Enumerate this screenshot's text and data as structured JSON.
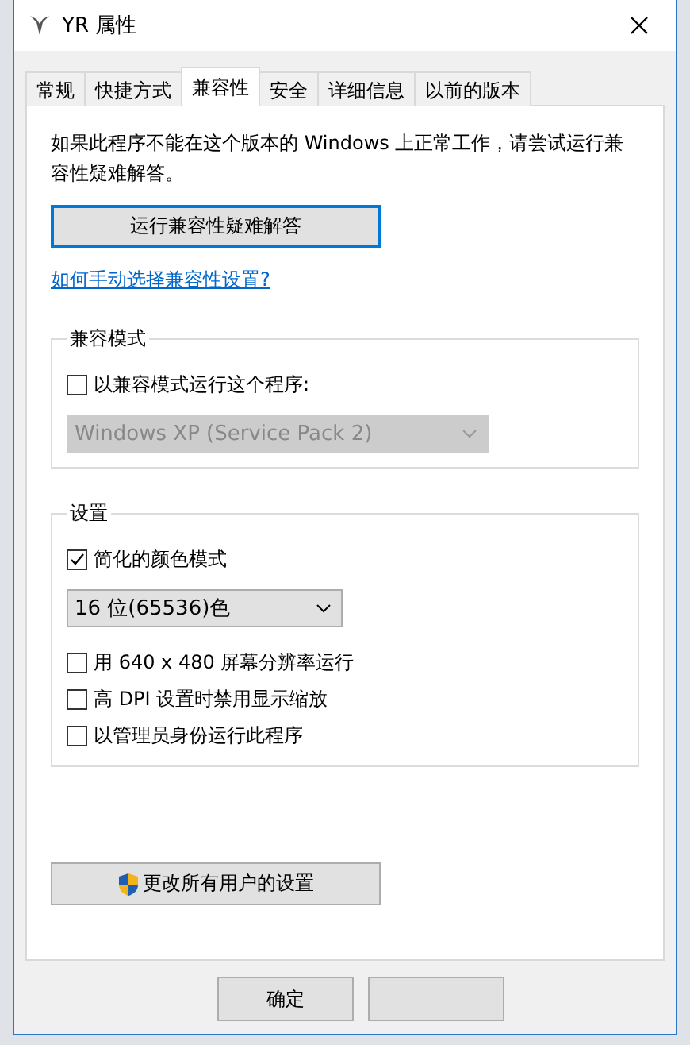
{
  "window": {
    "title": "YR 属性"
  },
  "tabs": [
    {
      "label": "常规",
      "selected": false
    },
    {
      "label": "快捷方式",
      "selected": false
    },
    {
      "label": "兼容性",
      "selected": true
    },
    {
      "label": "安全",
      "selected": false
    },
    {
      "label": "详细信息",
      "selected": false
    },
    {
      "label": "以前的版本",
      "selected": false
    }
  ],
  "intro": "如果此程序不能在这个版本的 Windows 上正常工作，请尝试运行兼容性疑难解答。",
  "troubleshoot_button": "运行兼容性疑难解答",
  "help_link": "如何手动选择兼容性设置?",
  "groups": [
    {
      "title": "兼容模式",
      "items": [
        {
          "kind": "checkbox",
          "label": "以兼容模式运行这个程序:",
          "checked": false
        },
        {
          "kind": "dropdown",
          "value": "Windows XP (Service Pack 2)",
          "disabled": true
        }
      ]
    },
    {
      "title": "设置",
      "items": [
        {
          "kind": "checkbox",
          "label": "简化的颜色模式",
          "checked": true
        },
        {
          "kind": "dropdown",
          "value": "16 位(65536)色",
          "disabled": false
        },
        {
          "kind": "checkbox",
          "label": "用 640 x 480 屏幕分辨率运行",
          "checked": false
        },
        {
          "kind": "checkbox",
          "label": "高 DPI 设置时禁用显示缩放",
          "checked": false
        },
        {
          "kind": "checkbox",
          "label": "以管理员身份运行此程序",
          "checked": false
        }
      ]
    }
  ],
  "all_users_button": "更改所有用户的设置",
  "buttons": [
    {
      "label": "确定"
    }
  ]
}
